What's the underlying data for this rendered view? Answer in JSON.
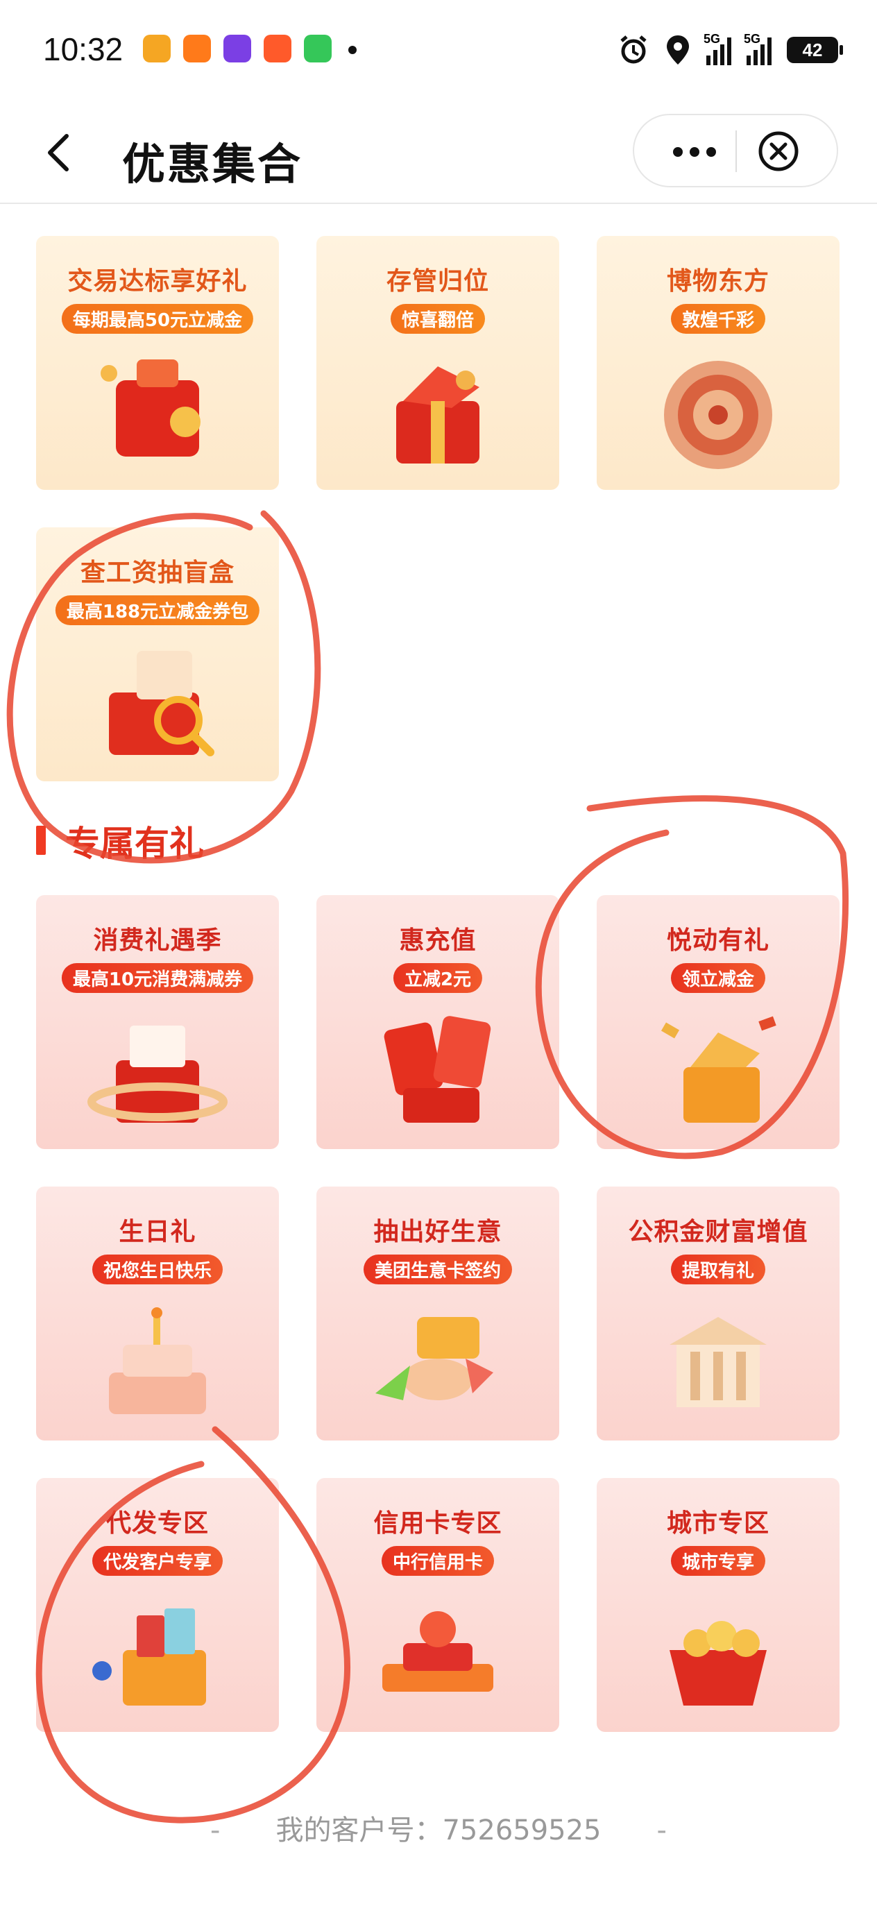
{
  "status_bar": {
    "time": "10:32",
    "app_icons": [
      {
        "name": "weibo-app-icon",
        "color": "#f5a623"
      },
      {
        "name": "taobao-flash-app-icon",
        "color": "#ff7a1a"
      },
      {
        "name": "bank-app-icon",
        "color": "#7b3fe4"
      },
      {
        "name": "gift-app-icon",
        "color": "#ff5a2a"
      },
      {
        "name": "video-app-icon",
        "color": "#35c759"
      }
    ],
    "signal_1_label": "5G",
    "signal_2_label": "5G",
    "battery": "42"
  },
  "navbar": {
    "title": "优惠集合"
  },
  "top_cards": [
    {
      "title": "交易达标享好礼",
      "subtitle": "每期最高50元立减金",
      "art": "gift-wallet-illustration"
    },
    {
      "title": "存管归位",
      "subtitle": "惊喜翻倍",
      "art": "red-gift-box-illustration"
    },
    {
      "title": "博物东方",
      "subtitle": "敦煌千彩",
      "art": "dunhuang-pattern-illustration"
    },
    {
      "title": "查工资抽盲盒",
      "subtitle": "最高188元立减金券包",
      "art": "blind-box-magnifier-illustration"
    }
  ],
  "section": {
    "title": "专属有礼"
  },
  "exclusive_cards": [
    {
      "title": "消费礼遇季",
      "subtitle": "最高10元消费满减券",
      "art": "coupon-gift-illustration"
    },
    {
      "title": "惠充值",
      "subtitle": "立减2元",
      "art": "red-envelope-illustration"
    },
    {
      "title": "悦动有礼",
      "subtitle": "领立减金",
      "art": "exploding-gift-illustration"
    },
    {
      "title": "生日礼",
      "subtitle": "祝您生日快乐",
      "art": "birthday-cake-illustration"
    },
    {
      "title": "抽出好生意",
      "subtitle": "美团生意卡签约",
      "art": "hand-card-illustration"
    },
    {
      "title": "公积金财富增值",
      "subtitle": "提取有礼",
      "art": "bank-building-illustration"
    },
    {
      "title": "代发专区",
      "subtitle": "代发客户专享",
      "art": "payroll-box-illustration"
    },
    {
      "title": "信用卡专区",
      "subtitle": "中行信用卡",
      "art": "credit-card-illustration"
    },
    {
      "title": "城市专区",
      "subtitle": "城市专享",
      "art": "coin-basket-illustration"
    }
  ],
  "footer": {
    "left_dash": "-",
    "customer_number": "我的客户号：752659525",
    "right_dash": "-"
  },
  "colors": {
    "accent_red": "#e1311d",
    "annotation_red": "#e8452f"
  }
}
